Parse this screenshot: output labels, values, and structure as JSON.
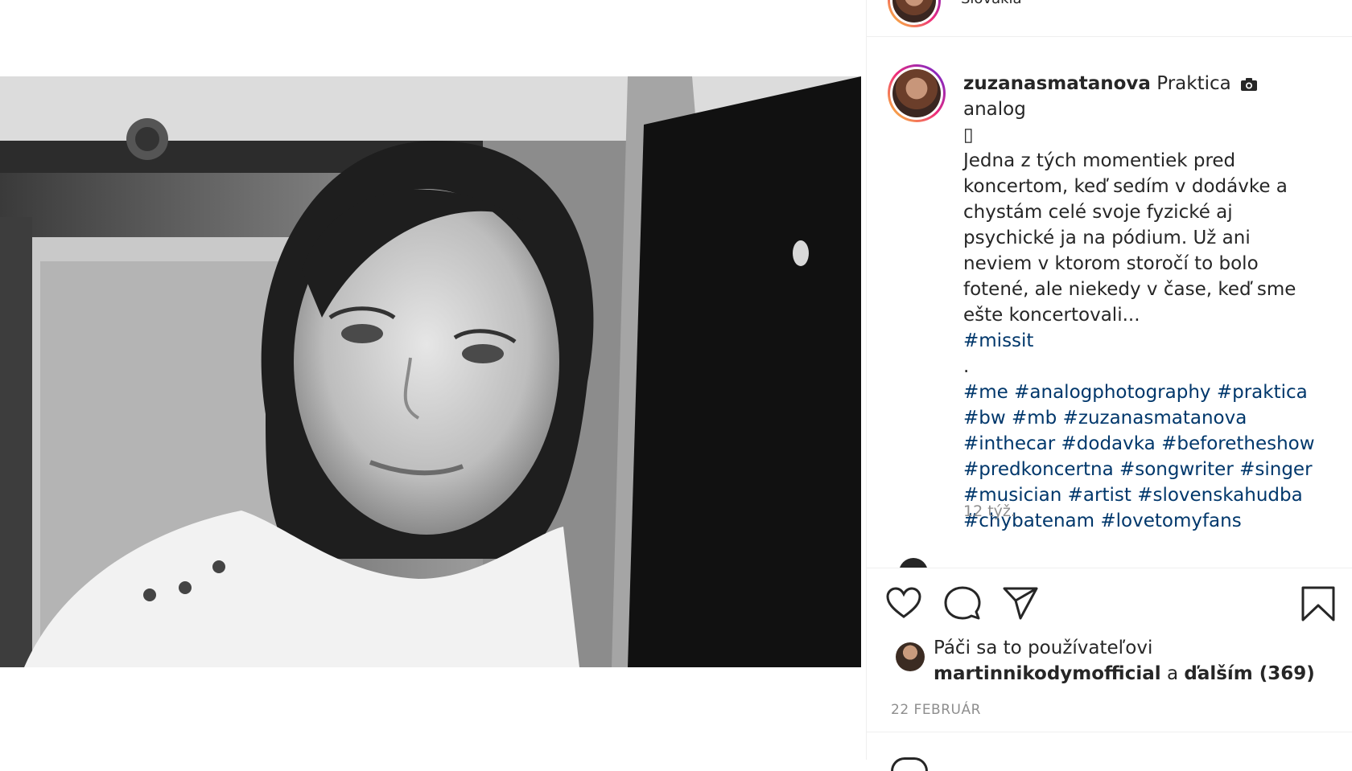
{
  "header": {
    "location": "Slovakia"
  },
  "post": {
    "username": "zuzanasmatanova",
    "caption_intro": "Praktica",
    "caption_after_icon": "analog",
    "caption_symbol": "▯",
    "caption_body": "Jedna z tých momentiek pred koncertom, keď sedím v dodávke a chystám celé svoje fyzické aj psychické ja na pódium. Už ani neviem v ktorom storočí to bolo fotené, ale niekedy v čase, keď sme ešte koncertovali...",
    "hashtag_first": "#missit",
    "dot": ".",
    "hashtags": [
      "#me",
      "#analogphotography",
      "#praktica",
      "#bw",
      "#mb",
      "#zuzanasmatanova",
      "#inthecar",
      "#dodavka",
      "#beforetheshow",
      "#predkoncertna",
      "#songwriter",
      "#singer",
      "#musician",
      "#artist",
      "#slovenskahudba",
      "#chybatenam",
      "#lovetomyfans"
    ],
    "time_ago": "12 týž.",
    "camera_icon": "camera-icon"
  },
  "actions": {
    "like_icon": "heart-icon",
    "comment_icon": "comment-icon",
    "share_icon": "paper-plane-icon",
    "save_icon": "bookmark-icon"
  },
  "likes": {
    "prefix": "Páči sa to používateľovi",
    "user": "martinnikodymofficial",
    "conjunction": "a",
    "others": "ďalším (369)"
  },
  "date": "22 FEBRUÁR",
  "colors": {
    "hashtag": "#00376b",
    "muted": "#8e8e8e",
    "text": "#262626"
  }
}
